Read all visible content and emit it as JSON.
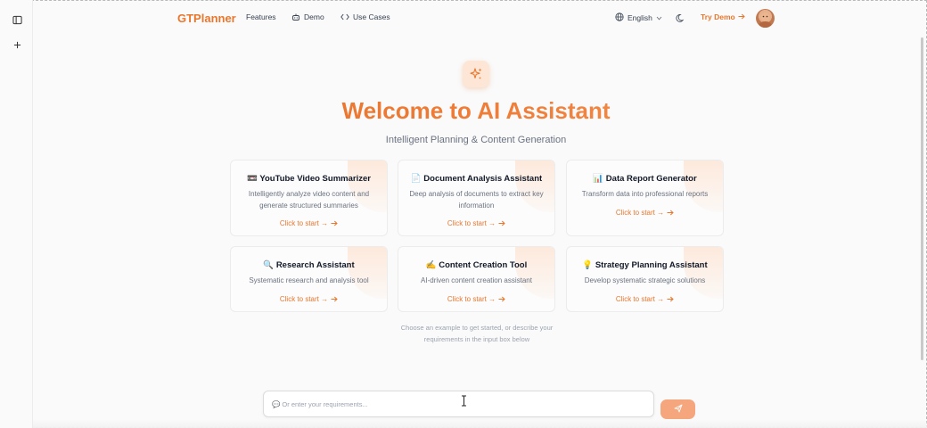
{
  "nav": {
    "brand": "GTPlanner",
    "features": "Features",
    "demo": "Demo",
    "use_cases": "Use Cases",
    "language": "English",
    "try_demo": "Try Demo"
  },
  "icons": {
    "sidebar_toggle": "panel-left-icon",
    "new": "plus-icon",
    "demo": "robot-icon",
    "use_cases": "code-icon",
    "language": "globe-icon",
    "theme": "moon-icon",
    "hero": "sparkles-icon",
    "send": "send-icon"
  },
  "hero": {
    "title": "Welcome to AI Assistant",
    "subtitle": "Intelligent Planning & Content Generation"
  },
  "cards": [
    {
      "emoji": "📼",
      "title": "YouTube Video Summarizer",
      "desc": "Intelligently analyze video content and generate structured summaries",
      "cta": "Click to start →"
    },
    {
      "emoji": "📄",
      "title": "Document Analysis Assistant",
      "desc": "Deep analysis of documents to extract key information",
      "cta": "Click to start →"
    },
    {
      "emoji": "📊",
      "title": "Data Report Generator",
      "desc": "Transform data into professional reports",
      "cta": "Click to start →"
    },
    {
      "emoji": "🔍",
      "title": "Research Assistant",
      "desc": "Systematic research and analysis tool",
      "cta": "Click to start →"
    },
    {
      "emoji": "✍️",
      "title": "Content Creation Tool",
      "desc": "AI-driven content creation assistant",
      "cta": "Click to start →"
    },
    {
      "emoji": "💡",
      "title": "Strategy Planning Assistant",
      "desc": "Develop systematic strategic solutions",
      "cta": "Click to start →"
    }
  ],
  "hint": "Choose an example to get started, or describe your requirements in the input box below",
  "input": {
    "placeholder": "💬 Or enter your requirements...",
    "value": ""
  },
  "colors": {
    "accent": "#e8772e",
    "send_button": "#f5a67c"
  }
}
